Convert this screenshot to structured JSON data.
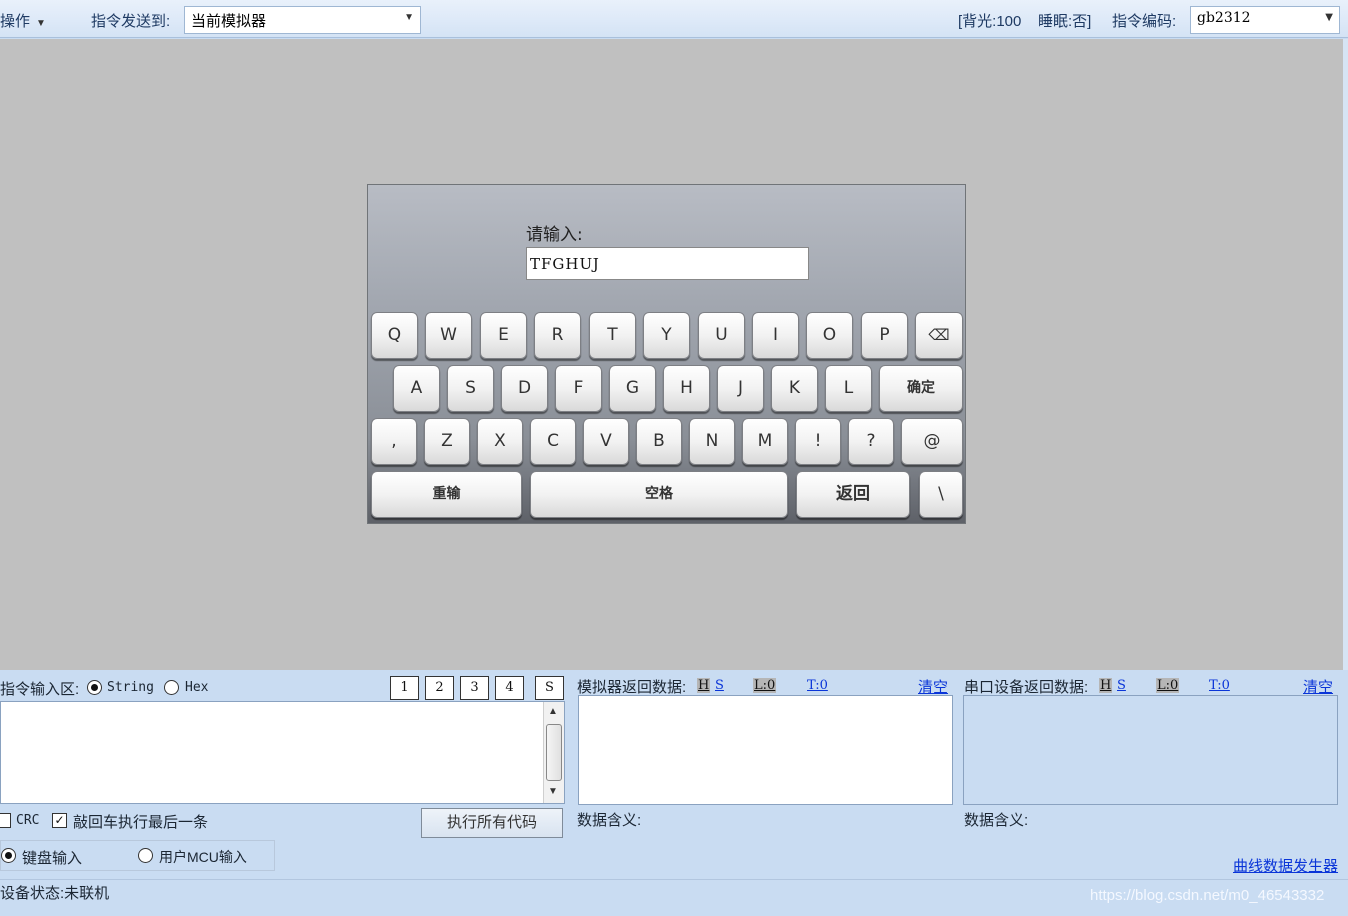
{
  "toolbar": {
    "menu_label": "操作",
    "send_to_label": "指令发送到:",
    "send_to_value": "当前模拟器",
    "backlight": "[背光:100",
    "sleep": "睡眠:否]",
    "encoding_label": "指令编码:",
    "encoding_value": "gb2312"
  },
  "keyboard": {
    "prompt": "请输入:",
    "input_value": "TFGHUJ",
    "row1": [
      "Q",
      "W",
      "E",
      "R",
      "T",
      "Y",
      "U",
      "I",
      "O",
      "P",
      "⌫"
    ],
    "row2": [
      "A",
      "S",
      "D",
      "F",
      "G",
      "H",
      "J",
      "K",
      "L",
      "确定"
    ],
    "row3": [
      ",",
      "Z",
      "X",
      "C",
      "V",
      "B",
      "N",
      "M",
      "!",
      "?",
      "@"
    ],
    "row4": [
      "重输",
      "空格",
      "返回",
      "\\"
    ]
  },
  "command_input": {
    "label": "指令输入区:",
    "mode_string": "String",
    "mode_hex": "Hex",
    "selected_mode": "String",
    "slots": [
      "1",
      "2",
      "3",
      "4",
      "S"
    ],
    "crc_label": "CRC",
    "crc_checked": false,
    "enter_exec_label": "敲回车执行最后一条",
    "enter_exec_checked": true,
    "run_all_button": "执行所有代码",
    "input_keyboard": "键盘输入",
    "input_mcu": "用户MCU输入",
    "selected_input": "键盘输入"
  },
  "simulator_return": {
    "label": "模拟器返回数据:",
    "h": "H",
    "s": "S",
    "l": "L:0",
    "t": "T:0",
    "clear": "清空",
    "meaning": "数据含义:"
  },
  "serial_return": {
    "label": "串口设备返回数据:",
    "h": "H",
    "s": "S",
    "l": "L:0",
    "t": "T:0",
    "clear": "清空",
    "meaning": "数据含义:",
    "curve_link": "曲线数据发生器"
  },
  "status": {
    "text": "设备状态:未联机",
    "watermark": "https://blog.csdn.net/m0_46543332"
  }
}
